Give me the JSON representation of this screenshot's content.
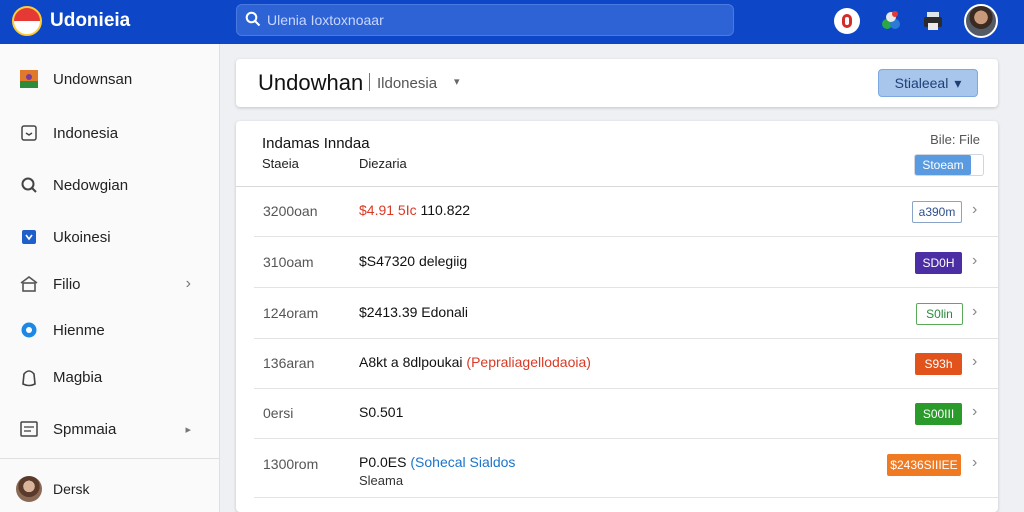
{
  "app": {
    "title": "Udonieia"
  },
  "search": {
    "placeholder": "Ulenia Ioxtoxnoaar"
  },
  "colors": {
    "topbar": "#0d47c8",
    "accent": "#5a9ae0"
  },
  "topbar_icons": [
    "alert-icon",
    "apps-icon",
    "print-icon",
    "user-avatar"
  ],
  "sidebar": {
    "items": [
      {
        "label": "Undownsan",
        "icon": "flag-icon"
      },
      {
        "label": "Indonesia",
        "icon": "inbox-icon"
      },
      {
        "label": "Nedowgian",
        "icon": "search-icon"
      },
      {
        "label": "Ukoinesi",
        "icon": "shield-icon"
      },
      {
        "label": "Filio",
        "icon": "home-icon",
        "chevron": "›"
      },
      {
        "label": "Hienme",
        "icon": "circle-icon"
      },
      {
        "label": "Magbia",
        "icon": "bag-icon"
      },
      {
        "label": "Spmmaia",
        "icon": "doc-icon",
        "chevron": "▸"
      }
    ],
    "user": {
      "name": "Dersk"
    }
  },
  "header": {
    "title": "Undowhan",
    "subtitle": "Ildonesia",
    "caret": "▾",
    "button_label": "Stialeeal",
    "button_caret": "▾"
  },
  "card": {
    "title": "Indamas Inndaa",
    "file_label": "Bile: File",
    "col1": "Staeia",
    "col2": "Diezaria",
    "toggle_label": "Stoeam"
  },
  "rows": [
    {
      "date": "3200oan",
      "amount_prefix": "$4.91 5Ic",
      "amount": " 110.822",
      "note": "",
      "note_color": "",
      "sub": "",
      "badge": "a390m",
      "badge_bg": "#ffffff",
      "badge_fg": "#2f4f8a",
      "badge_border": "#8aa4c8"
    },
    {
      "date": "310oam",
      "amount_prefix": "",
      "amount": "$S47320 delegiig",
      "note": "",
      "note_color": "",
      "sub": "",
      "badge": "SD0H",
      "badge_bg": "#4b2ea3",
      "badge_fg": "#ffffff",
      "badge_border": "#4b2ea3"
    },
    {
      "date": "124oram",
      "amount_prefix": "",
      "amount": "$2413.39 Edonali",
      "note": "",
      "note_color": "",
      "sub": "",
      "badge": "S0lin",
      "badge_bg": "#ffffff",
      "badge_fg": "#2a8a3a",
      "badge_border": "#5aaa5a"
    },
    {
      "date": "136aran",
      "amount_prefix": "",
      "amount": "A8kt a 8dlpoukai ",
      "note": "(Pepraliagellodaoia)",
      "note_color": "red",
      "sub": "",
      "badge": "S93h",
      "badge_bg": "#e2531c",
      "badge_fg": "#ffffff",
      "badge_border": "#e2531c"
    },
    {
      "date": "0ersi",
      "amount_prefix": "",
      "amount": "S0.501",
      "note": "",
      "note_color": "",
      "sub": "",
      "badge": "S00III",
      "badge_bg": "#2a9a2a",
      "badge_fg": "#ffffff",
      "badge_border": "#2a9a2a"
    },
    {
      "date": "1300rom",
      "amount_prefix": "",
      "amount": "P0.0ES ",
      "note": "(Sohecal Sialdos",
      "note_color": "blue",
      "sub": "Sleama",
      "badge": "$2436SIIIEE",
      "badge_bg": "#f07a22",
      "badge_fg": "#ffffff",
      "badge_border": "#f07a22"
    }
  ],
  "row_chevron": "›"
}
